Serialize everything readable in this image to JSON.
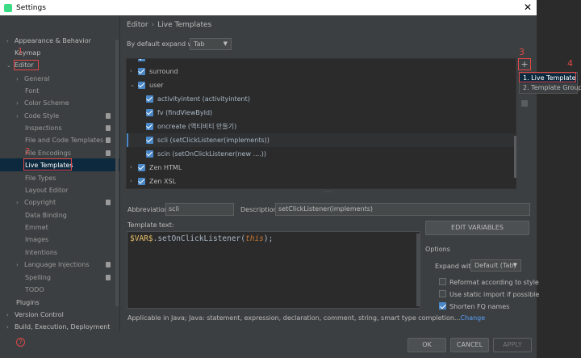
{
  "window": {
    "title": "Settings"
  },
  "sidebar": {
    "items": [
      {
        "label": "Appearance & Behavior"
      },
      {
        "label": "Keymap"
      },
      {
        "label": "Editor"
      },
      {
        "label": "General"
      },
      {
        "label": "Font"
      },
      {
        "label": "Color Scheme"
      },
      {
        "label": "Code Style"
      },
      {
        "label": "Inspections"
      },
      {
        "label": "File and Code Templates"
      },
      {
        "label": "File Encodings"
      },
      {
        "label": "Live Templates"
      },
      {
        "label": "File Types"
      },
      {
        "label": "Layout Editor"
      },
      {
        "label": "Copyright"
      },
      {
        "label": "Data Binding"
      },
      {
        "label": "Emmet"
      },
      {
        "label": "Images"
      },
      {
        "label": "Intentions"
      },
      {
        "label": "Language Injections"
      },
      {
        "label": "Spelling"
      },
      {
        "label": "TODO"
      },
      {
        "label": "Plugins"
      },
      {
        "label": "Version Control"
      },
      {
        "label": "Build, Execution, Deployment"
      }
    ]
  },
  "annotations": {
    "n1": "1",
    "n2": "2",
    "n3": "3",
    "n4": "4"
  },
  "breadcrumb": {
    "parent": "Editor",
    "sep": "›",
    "current": "Live Templates"
  },
  "expand": {
    "label": "By default expand with",
    "value": "Tab"
  },
  "templates": {
    "groups": [
      {
        "label": "surround"
      },
      {
        "label": "user"
      },
      {
        "label": "Zen HTML"
      },
      {
        "label": "Zen XSL"
      }
    ],
    "items": [
      {
        "label": "activityintent (activityintent)"
      },
      {
        "label": "fv (findViewById)"
      },
      {
        "label": "oncreate (액티비티 만들기)"
      },
      {
        "label": "scli (setClickListener(implements))"
      },
      {
        "label": "scin (setOnClickListener(new ....))"
      }
    ]
  },
  "toolbar": {
    "add": "+"
  },
  "popup": {
    "item1": "1. Live Template",
    "item2": "2. Template Group..."
  },
  "abbreviation": {
    "label": "Abbreviation:",
    "value": "scli"
  },
  "description": {
    "label": "Description:",
    "value": "setClickListener(implements)"
  },
  "template_text": {
    "label": "Template text:",
    "var": "$VAR$",
    "method": ".setOnClickListener(",
    "keyword": "this",
    "end": ");"
  },
  "edit_variables": "EDIT VARIABLES",
  "options": {
    "title": "Options",
    "expand_label": "Expand with",
    "expand_value": "Default (Tab)",
    "reformat": "Reformat according to style",
    "static_import": "Use static import if possible",
    "shorten": "Shorten FQ names"
  },
  "applicable": {
    "text": "Applicable in Java; Java: statement, expression, declaration, comment, string, smart type completion...",
    "link": "Change"
  },
  "footer": {
    "ok": "OK",
    "cancel": "CANCEL",
    "apply": "APPLY",
    "help": "?"
  }
}
